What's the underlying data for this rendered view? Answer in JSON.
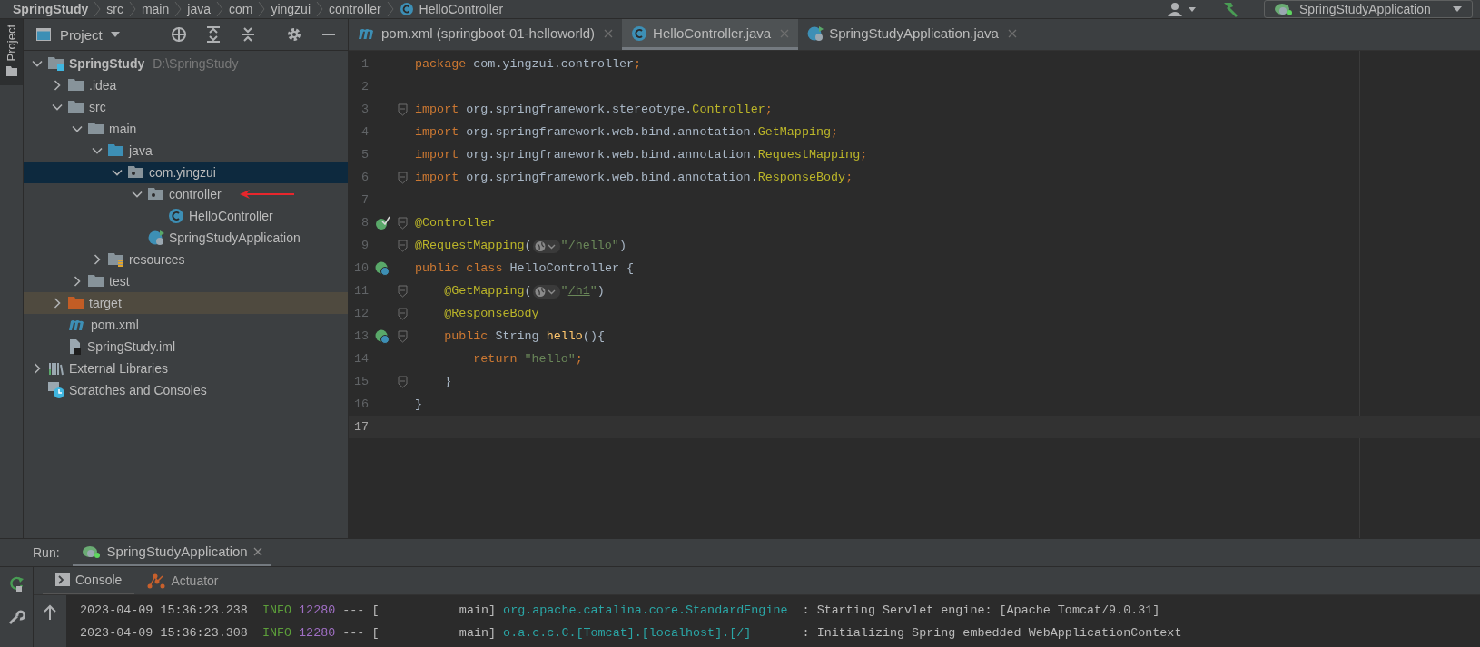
{
  "breadcrumb": [
    {
      "kind": "project",
      "text": "SpringStudy"
    },
    {
      "kind": "dir",
      "text": "src"
    },
    {
      "kind": "dir",
      "text": "main"
    },
    {
      "kind": "dir",
      "text": "java"
    },
    {
      "kind": "dir",
      "text": "com"
    },
    {
      "kind": "dir",
      "text": "yingzui"
    },
    {
      "kind": "dir",
      "text": "controller"
    },
    {
      "kind": "class",
      "text": "HelloController"
    }
  ],
  "toolbar": {
    "run_config": "SpringStudyApplication"
  },
  "side_strip": {
    "label": "Project"
  },
  "project_panel": {
    "title": "Project",
    "tree": [
      {
        "label": "SpringStudy",
        "location": "D:\\SpringStudy",
        "kind": "module",
        "expanded": true,
        "selected": false,
        "children": [
          {
            "label": ".idea",
            "kind": "folder",
            "expanded": false,
            "selected": false
          },
          {
            "label": "src",
            "kind": "folder",
            "expanded": true,
            "selected": false,
            "children": [
              {
                "label": "main",
                "kind": "folder",
                "expanded": true,
                "selected": false,
                "children": [
                  {
                    "label": "java",
                    "kind": "source-folder",
                    "expanded": true,
                    "selected": false,
                    "children": [
                      {
                        "label": "com.yingzui",
                        "kind": "package",
                        "expanded": true,
                        "selected": true,
                        "children": [
                          {
                            "label": "controller",
                            "kind": "package",
                            "expanded": true,
                            "selected": false,
                            "marked": true,
                            "children": [
                              {
                                "label": "HelloController",
                                "kind": "class",
                                "selected": false
                              }
                            ]
                          },
                          {
                            "label": "SpringStudyApplication",
                            "kind": "spring-class",
                            "selected": false
                          }
                        ]
                      }
                    ]
                  },
                  {
                    "label": "resources",
                    "kind": "resources-folder",
                    "expanded": false,
                    "selected": false
                  }
                ]
              },
              {
                "label": "test",
                "kind": "folder",
                "expanded": false,
                "selected": false
              }
            ]
          },
          {
            "label": "target",
            "kind": "excluded-folder",
            "expanded": false,
            "selected": false
          },
          {
            "label": "pom.xml",
            "kind": "maven",
            "selected": false
          },
          {
            "label": "SpringStudy.iml",
            "kind": "iml",
            "selected": false
          }
        ]
      },
      {
        "label": "External Libraries",
        "kind": "libraries",
        "expanded": false,
        "selected": false
      },
      {
        "label": "Scratches and Consoles",
        "kind": "scratches",
        "selected": false
      }
    ]
  },
  "editor_tabs": [
    {
      "label": "pom.xml (springboot-01-helloworld)",
      "kind": "maven",
      "selected": false
    },
    {
      "label": "HelloController.java",
      "kind": "class",
      "selected": true
    },
    {
      "label": "SpringStudyApplication.java",
      "kind": "spring-class",
      "selected": false
    }
  ],
  "code_lines": [
    {
      "number": "1",
      "kind": "plain",
      "fold": false,
      "current": false,
      "tokens": [
        {
          "kind": "keyword",
          "text": "package "
        },
        {
          "kind": "plain",
          "text": "com.yingzui.controller"
        },
        {
          "kind": "keyword",
          "text": ";"
        }
      ]
    },
    {
      "number": "2",
      "kind": "plain",
      "fold": false,
      "current": false
    },
    {
      "number": "3",
      "kind": "plain",
      "fold": true,
      "current": false,
      "tokens": [
        {
          "kind": "keyword",
          "text": "import "
        },
        {
          "kind": "plain",
          "text": "org.springframework.stereotype."
        },
        {
          "kind": "type",
          "text": "Controller"
        },
        {
          "kind": "keyword",
          "text": ";"
        }
      ]
    },
    {
      "number": "4",
      "kind": "plain",
      "fold": false,
      "current": false,
      "tokens": [
        {
          "kind": "keyword",
          "text": "import "
        },
        {
          "kind": "plain",
          "text": "org.springframework.web.bind.annotation."
        },
        {
          "kind": "type",
          "text": "GetMapping"
        },
        {
          "kind": "keyword",
          "text": ";"
        }
      ]
    },
    {
      "number": "5",
      "kind": "plain",
      "fold": false,
      "current": false,
      "tokens": [
        {
          "kind": "keyword",
          "text": "import "
        },
        {
          "kind": "plain",
          "text": "org.springframework.web.bind.annotation."
        },
        {
          "kind": "type",
          "text": "RequestMapping"
        },
        {
          "kind": "keyword",
          "text": ";"
        }
      ]
    },
    {
      "number": "6",
      "kind": "plain",
      "fold": true,
      "current": false,
      "tokens": [
        {
          "kind": "keyword",
          "text": "import "
        },
        {
          "kind": "plain",
          "text": "org.springframework.web.bind.annotation."
        },
        {
          "kind": "type",
          "text": "ResponseBody"
        },
        {
          "kind": "keyword",
          "text": ";"
        }
      ]
    },
    {
      "number": "7",
      "kind": "plain",
      "fold": false,
      "current": false
    },
    {
      "number": "8",
      "kind": "bean",
      "fold": true,
      "current": false,
      "tokens": [
        {
          "kind": "annotation",
          "text": "@Controller"
        }
      ]
    },
    {
      "number": "9",
      "kind": "plain",
      "fold": true,
      "current": false,
      "tokens": [
        {
          "kind": "annotation",
          "text": "@RequestMapping"
        },
        {
          "kind": "plain",
          "text": "("
        },
        {
          "kind": "globe"
        },
        {
          "kind": "string",
          "text": "\""
        },
        {
          "kind": "link",
          "text": "/hello"
        },
        {
          "kind": "string",
          "text": "\""
        },
        {
          "kind": "plain",
          "text": ")"
        }
      ]
    },
    {
      "number": "10",
      "kind": "web",
      "fold": false,
      "current": false,
      "tokens": [
        {
          "kind": "keyword",
          "text": "public class "
        },
        {
          "kind": "plain",
          "text": "HelloController {"
        }
      ]
    },
    {
      "number": "11",
      "kind": "plain",
      "fold": true,
      "current": false,
      "tokens": [
        {
          "kind": "annotation",
          "text": "    @GetMapping"
        },
        {
          "kind": "plain",
          "text": "("
        },
        {
          "kind": "globe"
        },
        {
          "kind": "string",
          "text": "\""
        },
        {
          "kind": "link",
          "text": "/h1"
        },
        {
          "kind": "string",
          "text": "\""
        },
        {
          "kind": "plain",
          "text": ")"
        }
      ]
    },
    {
      "number": "12",
      "kind": "plain",
      "fold": true,
      "current": false,
      "tokens": [
        {
          "kind": "annotation",
          "text": "    @ResponseBody"
        }
      ]
    },
    {
      "number": "13",
      "kind": "web",
      "fold": true,
      "current": false,
      "tokens": [
        {
          "kind": "keyword",
          "text": "    public "
        },
        {
          "kind": "plain",
          "text": "String "
        },
        {
          "kind": "method",
          "text": "hello"
        },
        {
          "kind": "plain",
          "text": "(){"
        }
      ]
    },
    {
      "number": "14",
      "kind": "plain",
      "fold": false,
      "current": false,
      "tokens": [
        {
          "kind": "keyword",
          "text": "        return "
        },
        {
          "kind": "string",
          "text": "\"hello\""
        },
        {
          "kind": "keyword",
          "text": ";"
        }
      ]
    },
    {
      "number": "15",
      "kind": "plain",
      "fold": true,
      "current": false,
      "tokens": [
        {
          "kind": "plain",
          "text": "    }"
        }
      ]
    },
    {
      "number": "16",
      "kind": "plain",
      "fold": false,
      "current": false,
      "tokens": [
        {
          "kind": "plain",
          "text": "}"
        }
      ]
    },
    {
      "number": "17",
      "kind": "plain",
      "fold": false,
      "current": true
    }
  ],
  "run_panel": {
    "label": "Run:",
    "tab": "SpringStudyApplication",
    "subtabs": [
      {
        "label": "Console",
        "kind": "console",
        "selected": true
      },
      {
        "label": "Actuator",
        "kind": "actuator",
        "selected": false
      }
    ],
    "log_lines": [
      [
        {
          "kind": "date",
          "text": "2023-04-09 15:36:23.238"
        },
        {
          "kind": "info",
          "text": "  INFO "
        },
        {
          "kind": "pid",
          "text": "12280"
        },
        {
          "kind": "text",
          "text": " --- [           main] "
        },
        {
          "kind": "logger",
          "text": "org.apache.catalina.core.StandardEngine"
        },
        {
          "kind": "text",
          "text": "  : Starting Servlet engine: [Apache Tomcat/9.0.31]"
        }
      ],
      [
        {
          "kind": "date",
          "text": "2023-04-09 15:36:23.308"
        },
        {
          "kind": "info",
          "text": "  INFO "
        },
        {
          "kind": "pid",
          "text": "12280"
        },
        {
          "kind": "text",
          "text": " --- [           main] "
        },
        {
          "kind": "logger",
          "text": "o.a.c.c.C.[Tomcat].[localhost].[/]"
        },
        {
          "kind": "text",
          "text": "       : Initializing Spring embedded WebApplicationContext"
        }
      ]
    ]
  }
}
